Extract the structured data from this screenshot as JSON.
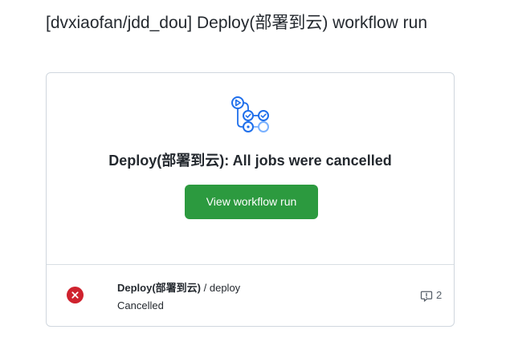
{
  "page": {
    "title": "[dvxiaofan/jdd_dou] Deploy(部署到云) workflow run"
  },
  "summary": {
    "icon": "workflow-icon",
    "headline": "Deploy(部署到云): All jobs were cancelled",
    "button_label": "View workflow run",
    "button_color": "#2c9a3f"
  },
  "jobs": [
    {
      "status_icon": "x-circle-fill-icon",
      "status_color": "#cf222e",
      "workflow_name": "Deploy(部署到云)",
      "separator": " / ",
      "job_name": "deploy",
      "status_text": "Cancelled",
      "annotation_icon": "comment-icon",
      "annotation_count": "2"
    }
  ]
}
